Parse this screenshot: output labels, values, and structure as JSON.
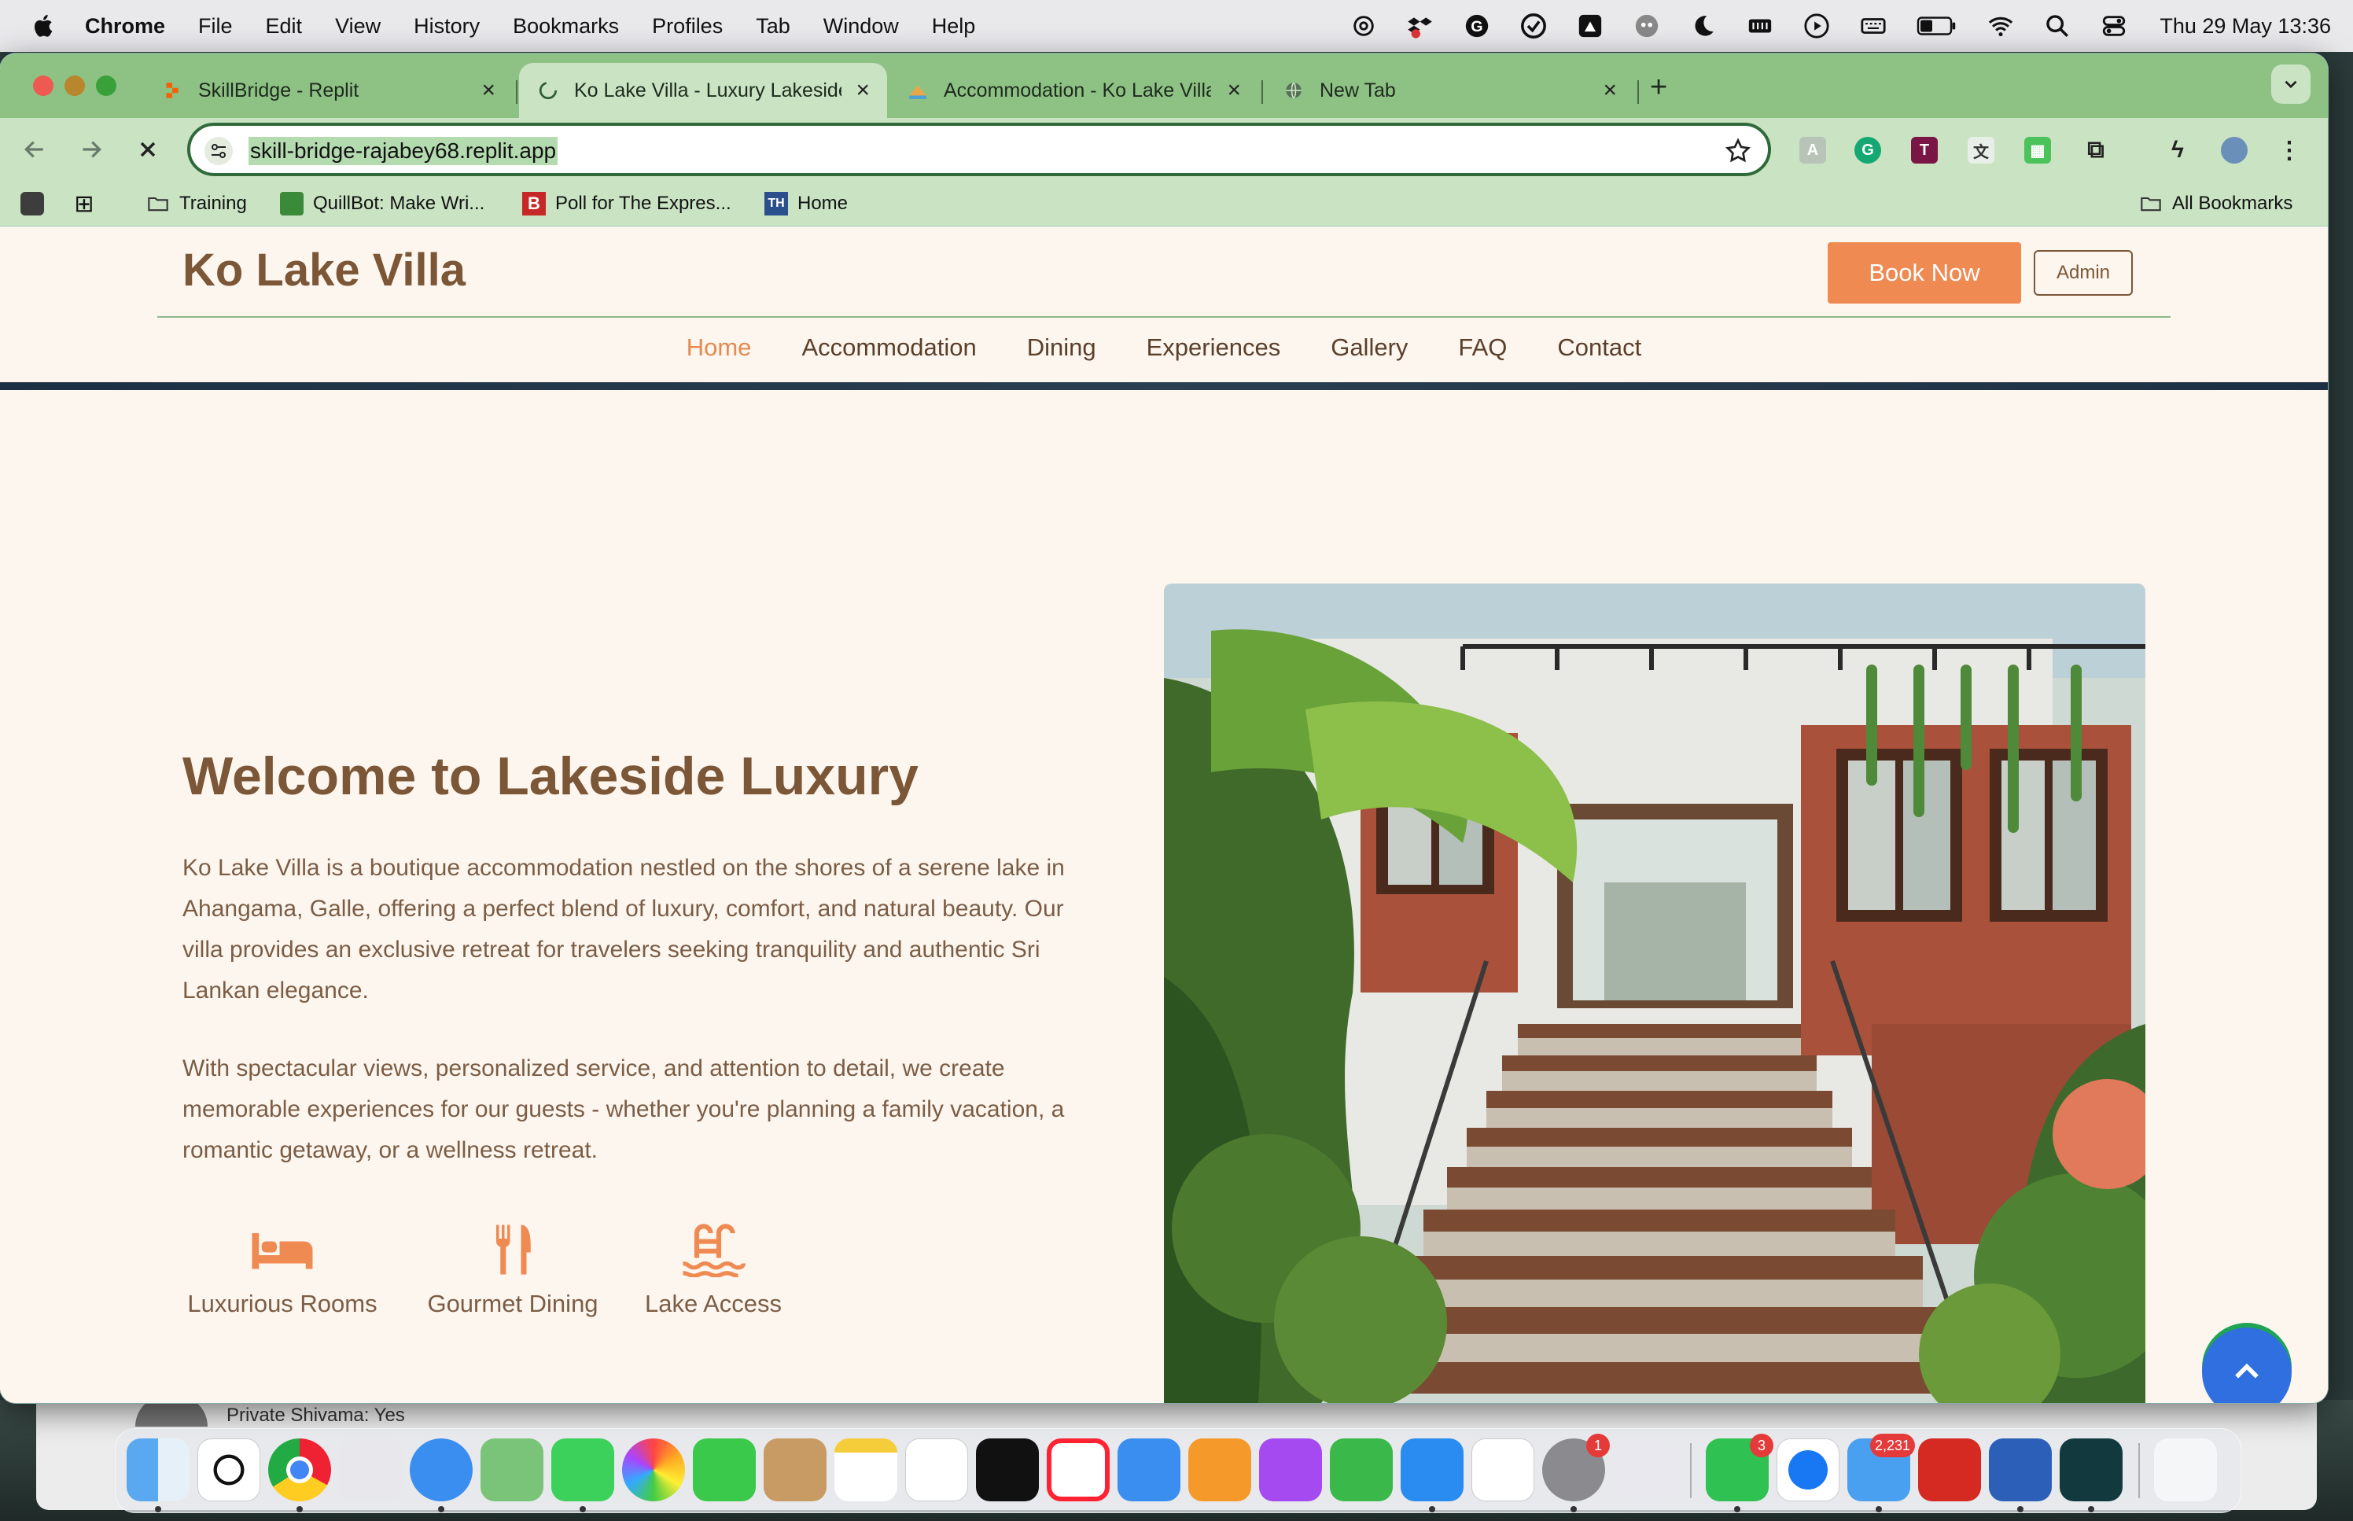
{
  "menubar": {
    "app_name": "Chrome",
    "items": [
      "File",
      "Edit",
      "View",
      "History",
      "Bookmarks",
      "Profiles",
      "Tab",
      "Window",
      "Help"
    ],
    "clock": "Thu 29 May  13:36"
  },
  "browser": {
    "tabs": [
      {
        "title": "SkillBridge - Replit",
        "icon": "replit-icon"
      },
      {
        "title": "Ko Lake Villa - Luxury Lakeside",
        "icon": "loading-icon"
      },
      {
        "title": "Accommodation - Ko Lake Villa",
        "icon": "villa-favicon"
      },
      {
        "title": "New Tab",
        "icon": "globe-icon"
      }
    ],
    "url": "skill-bridge-rajabey68.replit.app",
    "bookmarks": [
      {
        "label": "Training",
        "icon": "folder-icon"
      },
      {
        "label": "QuillBot: Make Wri...",
        "icon": "quillbot-icon"
      },
      {
        "label": "Poll for The Expres...",
        "icon": "poll-icon"
      },
      {
        "label": "Home",
        "icon": "home-icon"
      }
    ],
    "all_bookmarks": "All Bookmarks"
  },
  "site": {
    "logo": "Ko Lake Villa",
    "book_now": "Book Now",
    "admin": "Admin",
    "nav": [
      "Home",
      "Accommodation",
      "Dining",
      "Experiences",
      "Gallery",
      "FAQ",
      "Contact"
    ],
    "hero": {
      "title": "Welcome to Lakeside Luxury",
      "p1": "Ko Lake Villa is a boutique accommodation nestled on the shores of a serene lake in Ahangama, Galle, offering a perfect blend of luxury, comfort, and natural beauty. Our villa provides an exclusive retreat for travelers seeking tranquility and authentic Sri Lankan elegance.",
      "p2": "With spectacular views, personalized service, and attention to detail, we create memorable experiences for our guests - whether you're planning a family vacation, a romantic getaway, or a wellness retreat."
    },
    "features": [
      {
        "label": "Luxurious Rooms",
        "icon": "bed-icon"
      },
      {
        "label": "Gourmet Dining",
        "icon": "utensils-icon"
      },
      {
        "label": "Lake Access",
        "icon": "pool-ladder-icon"
      }
    ]
  },
  "background_window": {
    "text": "Private Shivama: Yes"
  },
  "dock": {
    "badges": {
      "system-settings": "1",
      "whatsapp": "3",
      "mail": "2,231"
    }
  },
  "colors": {
    "brand_brown": "#7b5637",
    "accent_orange": "#ee8a52",
    "page_bg": "#fdf6ee",
    "tab_green": "#8ec285"
  }
}
